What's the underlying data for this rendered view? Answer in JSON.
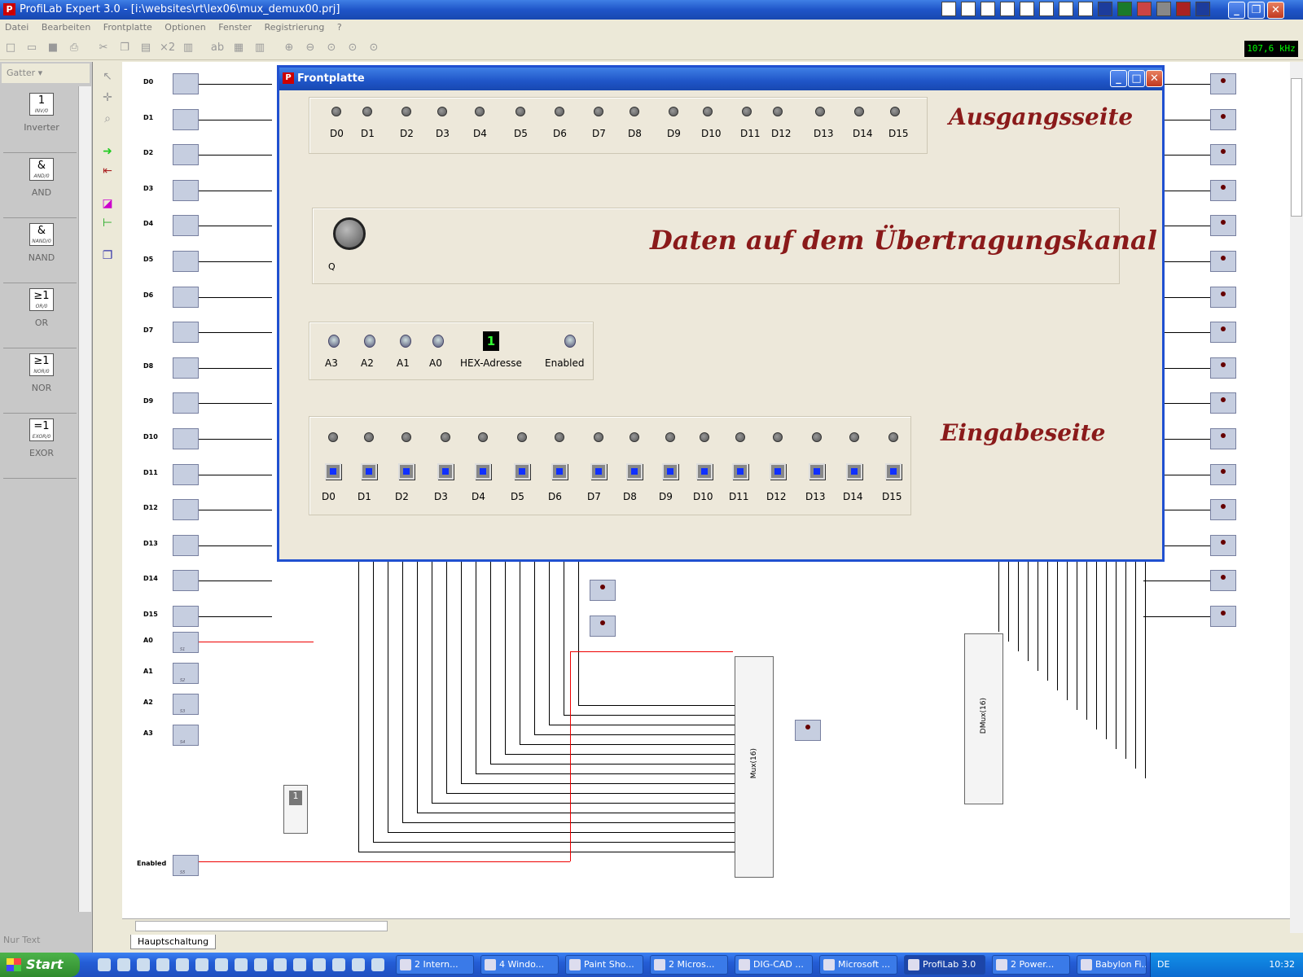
{
  "window": {
    "title": "ProfiLab Expert 3.0 - [i:\\websites\\rt\\lex06\\mux_demux00.prj]"
  },
  "menu": [
    "Datei",
    "Bearbeiten",
    "Frontplatte",
    "Optionen",
    "Fenster",
    "Registrierung",
    "?"
  ],
  "toolbar": {
    "freq": "107,6 kHz"
  },
  "palette": {
    "header": "Gatter",
    "items": [
      {
        "symbol": "1",
        "tag": "INV/0",
        "label": "Inverter"
      },
      {
        "symbol": "&",
        "tag": "AND/0",
        "label": "AND"
      },
      {
        "symbol": "&",
        "tag": "NAND/0",
        "label": "NAND"
      },
      {
        "symbol": "≥1",
        "tag": "OR/0",
        "label": "OR"
      },
      {
        "symbol": "≥1",
        "tag": "NOR/0",
        "label": "NOR"
      },
      {
        "symbol": "=1",
        "tag": "EXOR/0",
        "label": "EXOR"
      }
    ],
    "footer": "Nur Text"
  },
  "circuit": {
    "inputs": [
      "D0",
      "D1",
      "D2",
      "D3",
      "D4",
      "D5",
      "D6",
      "D7",
      "D8",
      "D9",
      "D10",
      "D11",
      "D12",
      "D13",
      "D14",
      "D15"
    ],
    "addr_inputs": [
      "A0",
      "A1",
      "A2",
      "A3"
    ],
    "enabled_label": "Enabled",
    "mux_label": "Mux(16)",
    "dmux_label": "DMux(16)",
    "led17": "LED17",
    "tab": "Hauptschaltung"
  },
  "front": {
    "title": "Frontplatte",
    "out_labels": [
      "D0",
      "D1",
      "D2",
      "D3",
      "D4",
      "D5",
      "D6",
      "D7",
      "D8",
      "D9",
      "D10",
      "D11",
      "D12",
      "D13",
      "D14",
      "D15"
    ],
    "out_heading": "Ausgangsseite",
    "channel_heading": "Daten auf dem Übertragungskanal",
    "q_label": "Q",
    "addr_labels": [
      "A3",
      "A2",
      "A1",
      "A0"
    ],
    "hex_value": "1",
    "hex_label": "HEX-Adresse",
    "enabled_label": "Enabled",
    "in_heading": "Eingabeseite",
    "in_labels": [
      "D0",
      "D1",
      "D2",
      "D3",
      "D4",
      "D5",
      "D6",
      "D7",
      "D8",
      "D9",
      "D10",
      "D11",
      "D12",
      "D13",
      "D14",
      "D15"
    ]
  },
  "taskbar": {
    "start": "Start",
    "tasks": [
      "2 Intern...",
      "4 Windo...",
      "Paint Sho...",
      "2 Micros...",
      "DIG-CAD ...",
      "Microsoft ...",
      "ProfiLab 3.0",
      "2 Power...",
      "Babylon Fi..."
    ],
    "lang": "DE",
    "clock": "10:32"
  }
}
